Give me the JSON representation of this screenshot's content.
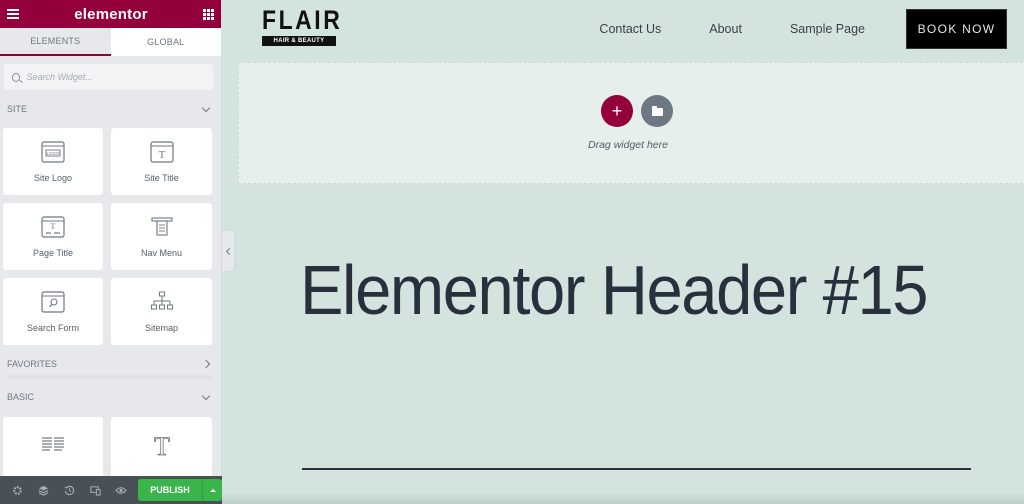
{
  "panel": {
    "brand": "elementor",
    "tabs": [
      {
        "label": "ELEMENTS",
        "active": true
      },
      {
        "label": "GLOBAL",
        "active": false
      }
    ],
    "search": {
      "placeholder": "Search Widget...",
      "value": ""
    },
    "sections": {
      "site": {
        "label": "SITE",
        "widgets": [
          {
            "label": "Site Logo",
            "icon": "site-logo-icon"
          },
          {
            "label": "Site Title",
            "icon": "site-title-icon"
          },
          {
            "label": "Page Title",
            "icon": "page-title-icon"
          },
          {
            "label": "Nav Menu",
            "icon": "nav-menu-icon"
          },
          {
            "label": "Search Form",
            "icon": "search-form-icon"
          },
          {
            "label": "Sitemap",
            "icon": "sitemap-icon"
          }
        ]
      },
      "favorites": {
        "label": "FAVORITES"
      },
      "basic": {
        "label": "BASIC",
        "widgets": [
          {
            "label": "",
            "icon": "columns-icon"
          },
          {
            "label": "",
            "icon": "heading-icon"
          }
        ]
      }
    },
    "footer": {
      "icons": [
        "settings-icon",
        "navigator-icon",
        "history-icon",
        "responsive-icon",
        "preview-icon"
      ],
      "publish_label": "PUBLISH"
    }
  },
  "site": {
    "logo": {
      "word": "FLAIR",
      "tagline": "HAIR & BEAUTY"
    },
    "nav": [
      {
        "label": "Contact Us"
      },
      {
        "label": "About"
      },
      {
        "label": "Sample Page"
      }
    ],
    "cta": "BOOK NOW",
    "drop_zone_text": "Drag widget here",
    "hero_title": "Elementor Header #15"
  },
  "colors": {
    "brand": "#93003c",
    "publish": "#39b54a",
    "canvas_bg": "#d3e4de",
    "footer_bg": "#495157",
    "heading": "#28303d"
  }
}
